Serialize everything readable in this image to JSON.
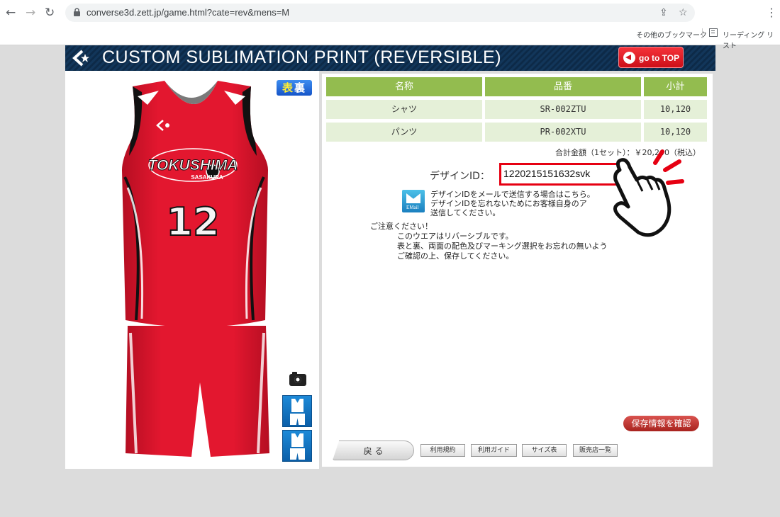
{
  "browser": {
    "url": "converse3d.zett.jp/game.html?cate=rev&mens=M",
    "bookmarks": {
      "other": "その他のブックマーク",
      "reading_list": "リーディング リスト"
    }
  },
  "header": {
    "title": "CUSTOM SUBLIMATION PRINT (REVERSIBLE)",
    "goto_top": "go to TOP"
  },
  "preview": {
    "side_toggle": {
      "front": "表",
      "back": "裏"
    },
    "team_name": "TOKUSHIMA",
    "team_sub": "SASAKURA",
    "number": "12",
    "colors": {
      "primary": "#e3172f",
      "accent": "#111111",
      "trim": "#ffffff"
    }
  },
  "table": {
    "headers": [
      "名称",
      "品番",
      "小計"
    ],
    "rows": [
      {
        "name": "シャツ",
        "code": "SR-002ZTU",
        "subtotal": "10,120"
      },
      {
        "name": "パンツ",
        "code": "PR-002XTU",
        "subtotal": "10,120"
      }
    ],
    "total": "合計金額（1セット）：￥20,240（税込）"
  },
  "design": {
    "label": "デザインID：",
    "id": "1220215151632svk"
  },
  "email": {
    "icon_label": "EMail",
    "lines": [
      "デザインIDをメールで送信する場合はこちら。",
      "デザインIDを忘れないためにお客様自身のア",
      "送信してください。"
    ]
  },
  "notice": {
    "heading": "ご注意ください！",
    "lines": [
      "このウエアはリバーシブルです。",
      "表と裏、両面の配色及びマーキング選択をお忘れの無いよう",
      "ご確認の上、保存してください。"
    ]
  },
  "buttons": {
    "save": "保存情報を確認",
    "back": "戻 る",
    "terms": "利用規約",
    "guide": "利用ガイド",
    "size": "サイズ表",
    "stores": "販売店一覧"
  }
}
